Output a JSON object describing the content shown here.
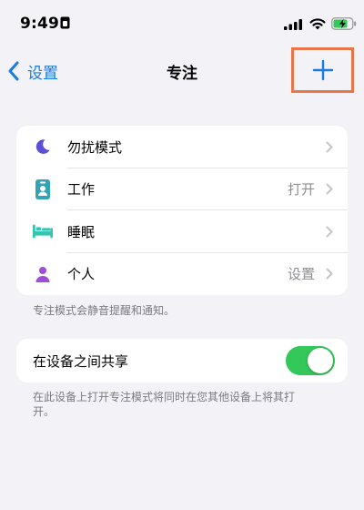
{
  "status_bar": {
    "time": "9:49"
  },
  "nav": {
    "back_label": "设置",
    "title": "专注",
    "add_icon": "plus-icon"
  },
  "focus_list": [
    {
      "label": "勿扰模式",
      "value": "",
      "icon": "moon-icon",
      "icon_color": "#5b4fd6"
    },
    {
      "label": "工作",
      "value": "打开",
      "icon": "badge-icon",
      "icon_color": "#33a3b5"
    },
    {
      "label": "睡眠",
      "value": "",
      "icon": "bed-icon",
      "icon_color": "#36c3b0"
    },
    {
      "label": "个人",
      "value": "设置",
      "icon": "person-icon",
      "icon_color": "#9e4fd6"
    }
  ],
  "focus_footnote": "专注模式会静音提醒和通知。",
  "share": {
    "label": "在设备之间共享",
    "enabled": true,
    "footnote": "在此设备上打开专注模式将同时在您其他设备上将其打开。"
  },
  "colors": {
    "accent": "#1a7be0",
    "toggle_on": "#34c759",
    "highlight_box": "#e8764a"
  }
}
